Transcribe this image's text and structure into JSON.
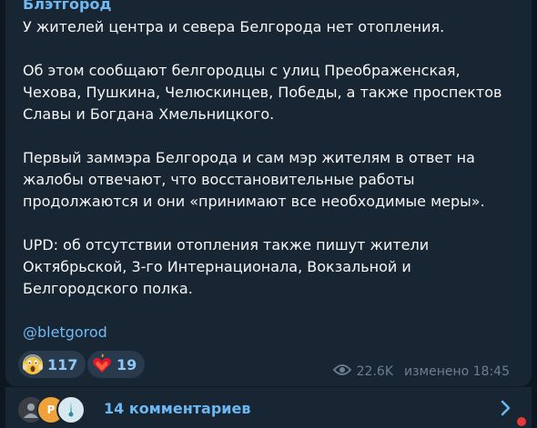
{
  "post": {
    "channel": "Блэтгород",
    "lines": [
      "У жителей центра и севера Белгорода нет отопления.",
      "Об этом сообщают белгородцы с улиц Преображенская,",
      "Чехова, Пушкина, Челюскинцев, Победы, а также проспектов",
      "Славы и Богдана Хмельницкого.",
      "Первый заммэра Белгорода и сам мэр жителям в ответ на",
      "жалобы отвечают, что восстановительные работы",
      "продолжаются и они «принимают все необходимые меры».",
      "UPD: об отсутствии отопления также пишут жители",
      "Октябрьской, 3-го Интернационала, Вокзальной и",
      "Белгородского полка."
    ],
    "link": "@bletgorod"
  },
  "reactions": [
    {
      "emoji": "scream-emoji-icon",
      "count": "117"
    },
    {
      "emoji": "heart-on-fire-icon",
      "count": "19"
    }
  ],
  "meta": {
    "views": "22.6K",
    "edited": "изменено 18:45"
  },
  "comments": {
    "label": "14 комментариев",
    "avatar_letters": [
      "P"
    ]
  },
  "colors": {
    "background": "#0e1621",
    "bubble": "#182533",
    "accent": "#71b9f2",
    "text": "#f5f5f5"
  }
}
